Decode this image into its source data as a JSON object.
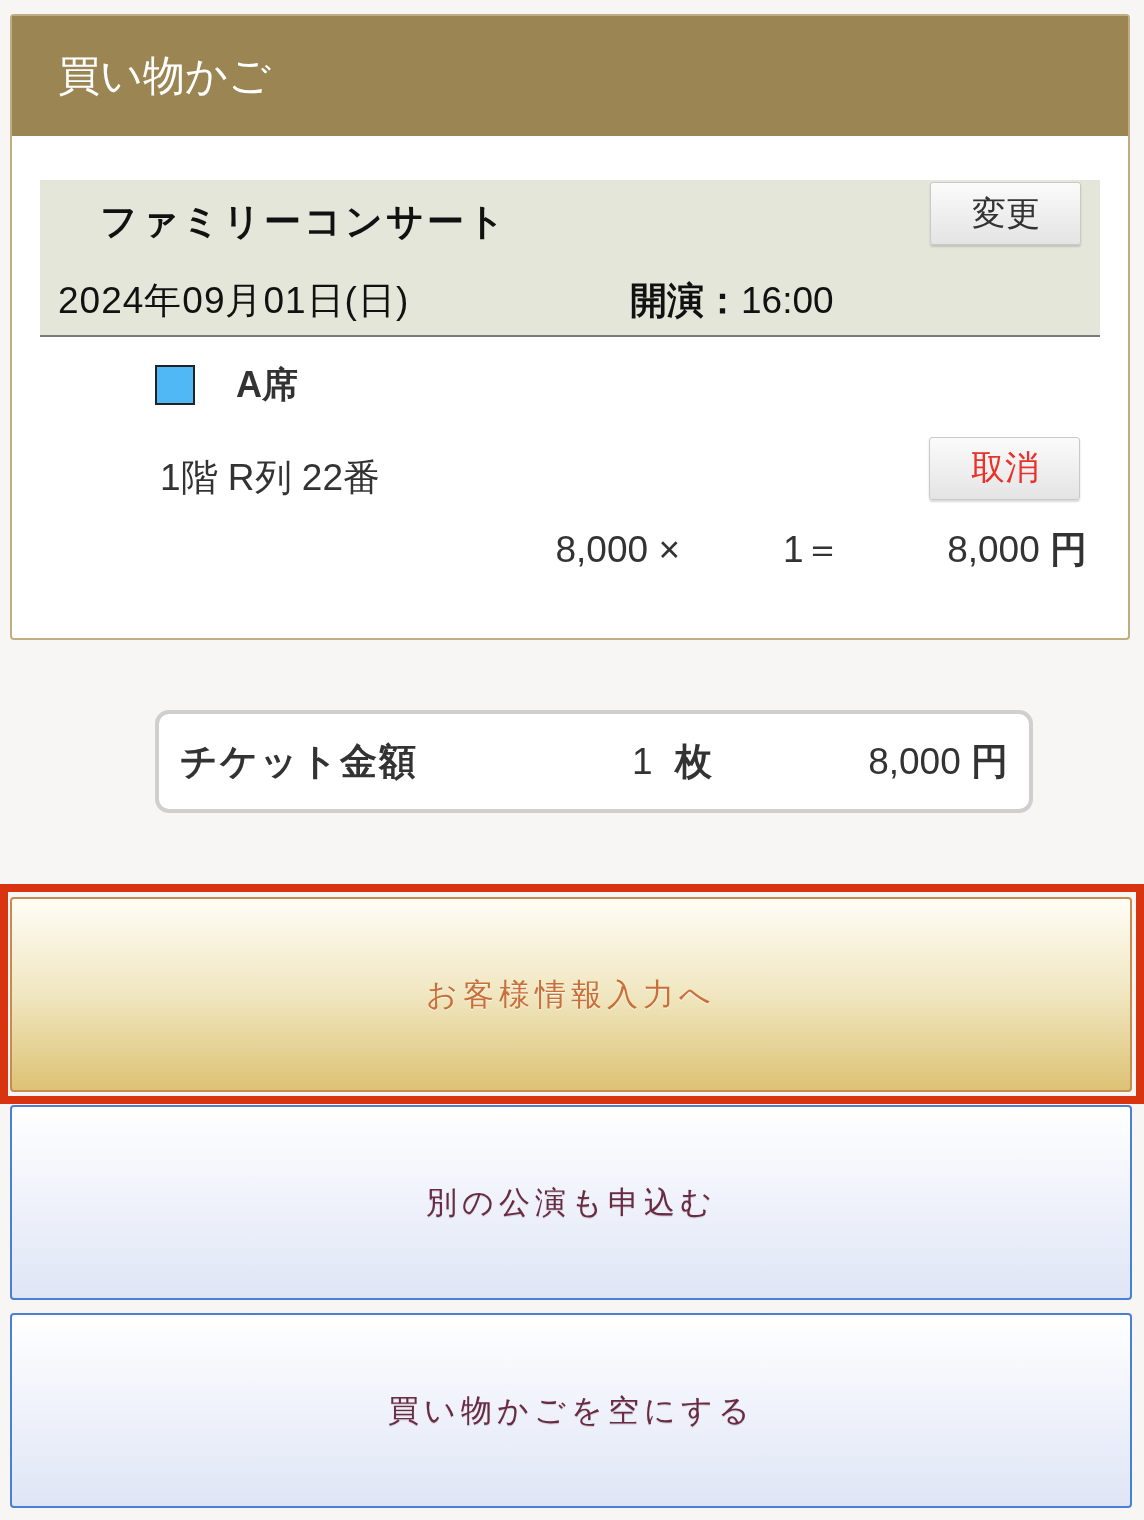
{
  "cart": {
    "title": "買い物かご",
    "events": [
      {
        "name": "ファミリーコンサート",
        "change_button": "変更",
        "date": "2024年09月01日(日)",
        "start_time": "**開演：**16:00",
        "seats": [
          {
            "seat_class": "A席",
            "color": "#4fb8f5",
            "location": "1階 R列 22番",
            "cancel_button": "取消",
            "unit_price": "8,000 ×",
            "quantity": "1＝",
            "subtotal": "8,000 **円**"
          }
        ]
      }
    ]
  },
  "summary": {
    "label": "チケット金額",
    "count": "1 **枚**",
    "total": "8,000 **円**"
  },
  "buttons": [
    {
      "label": "お客様情報入力へ",
      "kind": "primary",
      "highlighted": true
    },
    {
      "label": "別の公演も申込む",
      "kind": "secondary",
      "highlighted": false
    },
    {
      "label": "買い物かごを空にする",
      "kind": "secondary",
      "highlighted": false
    }
  ]
}
